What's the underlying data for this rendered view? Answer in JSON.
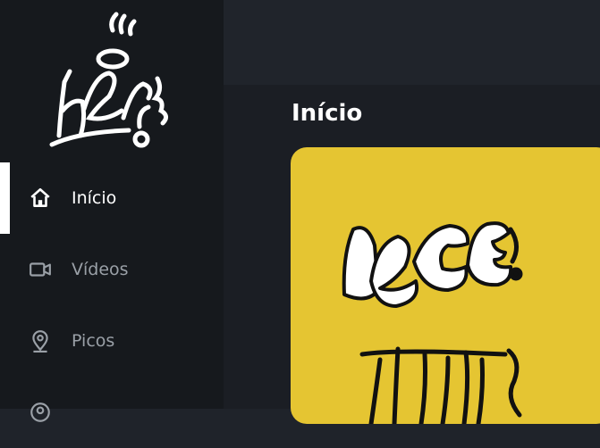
{
  "app": {
    "logo_alt": "logo-graffiti"
  },
  "sidebar": {
    "items": [
      {
        "label": "Início",
        "icon": "home-icon",
        "active": true
      },
      {
        "label": "Vídeos",
        "icon": "video-camera-icon",
        "active": false
      },
      {
        "label": "Picos",
        "icon": "map-pin-icon",
        "active": false
      }
    ]
  },
  "main": {
    "title": "Início"
  },
  "colors": {
    "sidebar_bg": "#16191d",
    "main_bg": "#1b1e24",
    "topbar_bg": "#20242b",
    "hero_bg": "#e5c532",
    "active_text": "#ffffff",
    "inactive_text": "#9aa0a7"
  }
}
